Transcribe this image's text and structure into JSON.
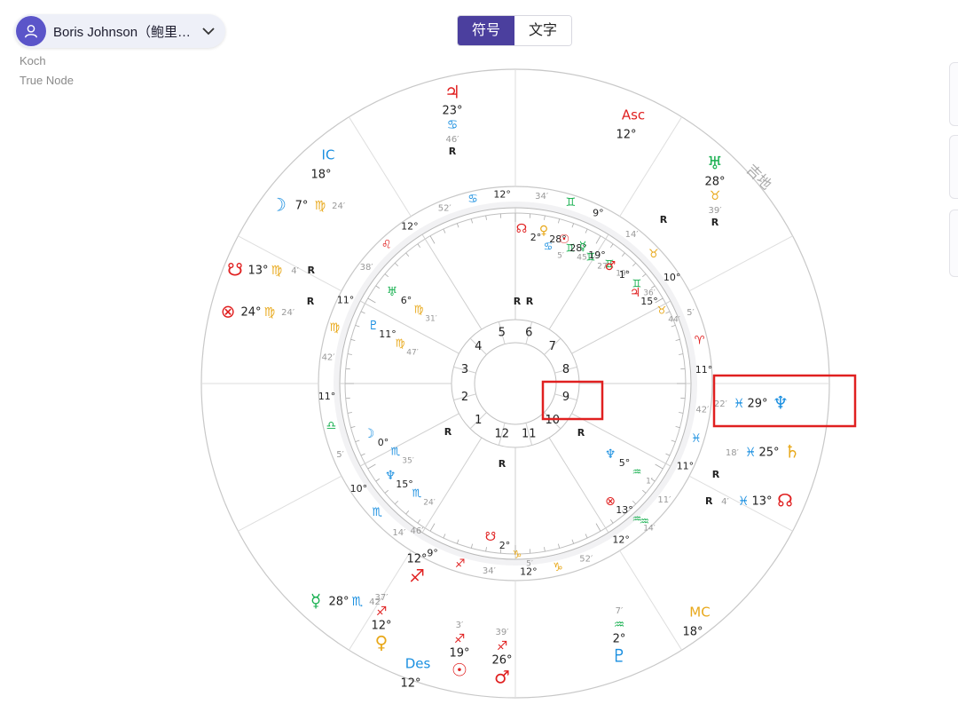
{
  "profile": {
    "name": "Boris Johnson（鲍里…",
    "house_system": "Koch",
    "node_type": "True Node"
  },
  "view_toggle": {
    "symbols_label": "符号",
    "text_label": "文字",
    "active": "符号"
  },
  "colors": {
    "fire": "#e02020",
    "earth": "#e8a81a",
    "air": "#18b050",
    "water": "#1a8fe0",
    "highlight": "#e02020",
    "accent": "#4b3f9e"
  },
  "chart": {
    "axes": {
      "asc": {
        "label": "Asc",
        "sign": "gemini",
        "deg": "12"
      },
      "mc": {
        "label": "MC",
        "sign": "aquarius",
        "deg": "18"
      },
      "ic": {
        "label": "IC",
        "sign": "leo",
        "deg": "18"
      },
      "des": {
        "label": "Des",
        "sign": "sagittarius",
        "deg": "12"
      }
    },
    "outer_planets": [
      {
        "id": "jupiter",
        "symbol": "♃",
        "deg": "23",
        "sign": "♋",
        "min": "46",
        "retro": "R"
      },
      {
        "id": "uranus",
        "symbol": "♅",
        "deg": "28",
        "sign": "♉",
        "min": "39",
        "retro": "R"
      },
      {
        "id": "moon",
        "symbol": "☽",
        "deg": "7",
        "sign": "♍",
        "min": "24"
      },
      {
        "id": "south-node",
        "symbol": "☋",
        "deg": "13",
        "sign": "♍",
        "min": "4",
        "retro": "R"
      },
      {
        "id": "fortune",
        "symbol": "⊗",
        "deg": "24",
        "sign": "♍",
        "min": "24"
      },
      {
        "id": "neptune",
        "symbol": "♆",
        "deg": "29",
        "sign": "♓",
        "min": "22"
      },
      {
        "id": "saturn",
        "symbol": "♄",
        "deg": "25",
        "sign": "♓",
        "min": "18"
      },
      {
        "id": "north-node",
        "symbol": "☊",
        "deg": "13",
        "sign": "♓",
        "min": "4",
        "retro": "R"
      },
      {
        "id": "pluto",
        "symbol": "♇",
        "deg": "2",
        "sign": "♒",
        "min": "7"
      },
      {
        "id": "mercury",
        "symbol": "☿",
        "deg": "28",
        "sign": "♏",
        "min": "42"
      },
      {
        "id": "venus",
        "symbol": "♀",
        "deg": "12",
        "sign": "♐",
        "min": "37"
      },
      {
        "id": "sun",
        "symbol": "☉",
        "deg": "19",
        "sign": "♐",
        "min": "3"
      },
      {
        "id": "mars",
        "symbol": "♂",
        "deg": "26",
        "sign": "♐",
        "min": "39"
      },
      {
        "id": "venus-2",
        "symbol": "♐",
        "deg": "12",
        "min": "46"
      }
    ],
    "cusps": [
      {
        "deg": "12",
        "sign": "♋",
        "min": "52"
      },
      {
        "deg": "9",
        "sign": "♊",
        "min": "34"
      },
      {
        "deg": "10",
        "sign": "♉",
        "min": "14"
      },
      {
        "deg": "11",
        "sign": "♈",
        "min": "5"
      },
      {
        "deg": "11",
        "sign": "♓",
        "min": "42"
      },
      {
        "deg": "12",
        "sign": "♒",
        "min": "11"
      },
      {
        "deg": "12",
        "sign": "♑",
        "min": "52"
      },
      {
        "deg": "9",
        "sign": "♐",
        "min": "34"
      },
      {
        "deg": "10",
        "sign": "♏",
        "min": "14"
      },
      {
        "deg": "11",
        "sign": "♎",
        "min": "5"
      },
      {
        "deg": "11",
        "sign": "♍",
        "min": "42"
      },
      {
        "deg": "12",
        "sign": "♌",
        "min": "38"
      }
    ],
    "inner_planets": [
      {
        "symbol": "☊",
        "deg": "2",
        "sign": "♋",
        "min": "5"
      },
      {
        "symbol": "♀",
        "deg": "28",
        "sign": "♊",
        "min": "45"
      },
      {
        "symbol": "☉",
        "deg": "28",
        "sign": "♊",
        "min": "27"
      },
      {
        "symbol": "☿",
        "deg": "19",
        "sign": "♊",
        "min": "19"
      },
      {
        "symbol": "♂",
        "deg": "1",
        "sign": "♊",
        "min": "36"
      },
      {
        "symbol": "♃",
        "deg": "15",
        "sign": "♉",
        "min": "44"
      },
      {
        "symbol": "♅",
        "deg": "6",
        "sign": "♍",
        "min": "31"
      },
      {
        "symbol": "♇",
        "deg": "11",
        "sign": "♍",
        "min": "47"
      },
      {
        "symbol": "☽",
        "deg": "0",
        "sign": "♏",
        "min": "35"
      },
      {
        "symbol": "♆",
        "deg": "15",
        "sign": "♏",
        "min": "24"
      },
      {
        "symbol": "♆",
        "deg": "5",
        "sign": "♒",
        "min": "1"
      },
      {
        "symbol": "⊗",
        "deg": "13",
        "sign": "♒",
        "min": "14"
      },
      {
        "symbol": "☋",
        "deg": "2",
        "sign": "♑",
        "min": "5"
      }
    ],
    "house_numbers": [
      "1",
      "2",
      "3",
      "4",
      "5",
      "6",
      "7",
      "8",
      "9",
      "10",
      "11",
      "12"
    ],
    "retro_marker": "R",
    "aspect_label": "吉地"
  }
}
